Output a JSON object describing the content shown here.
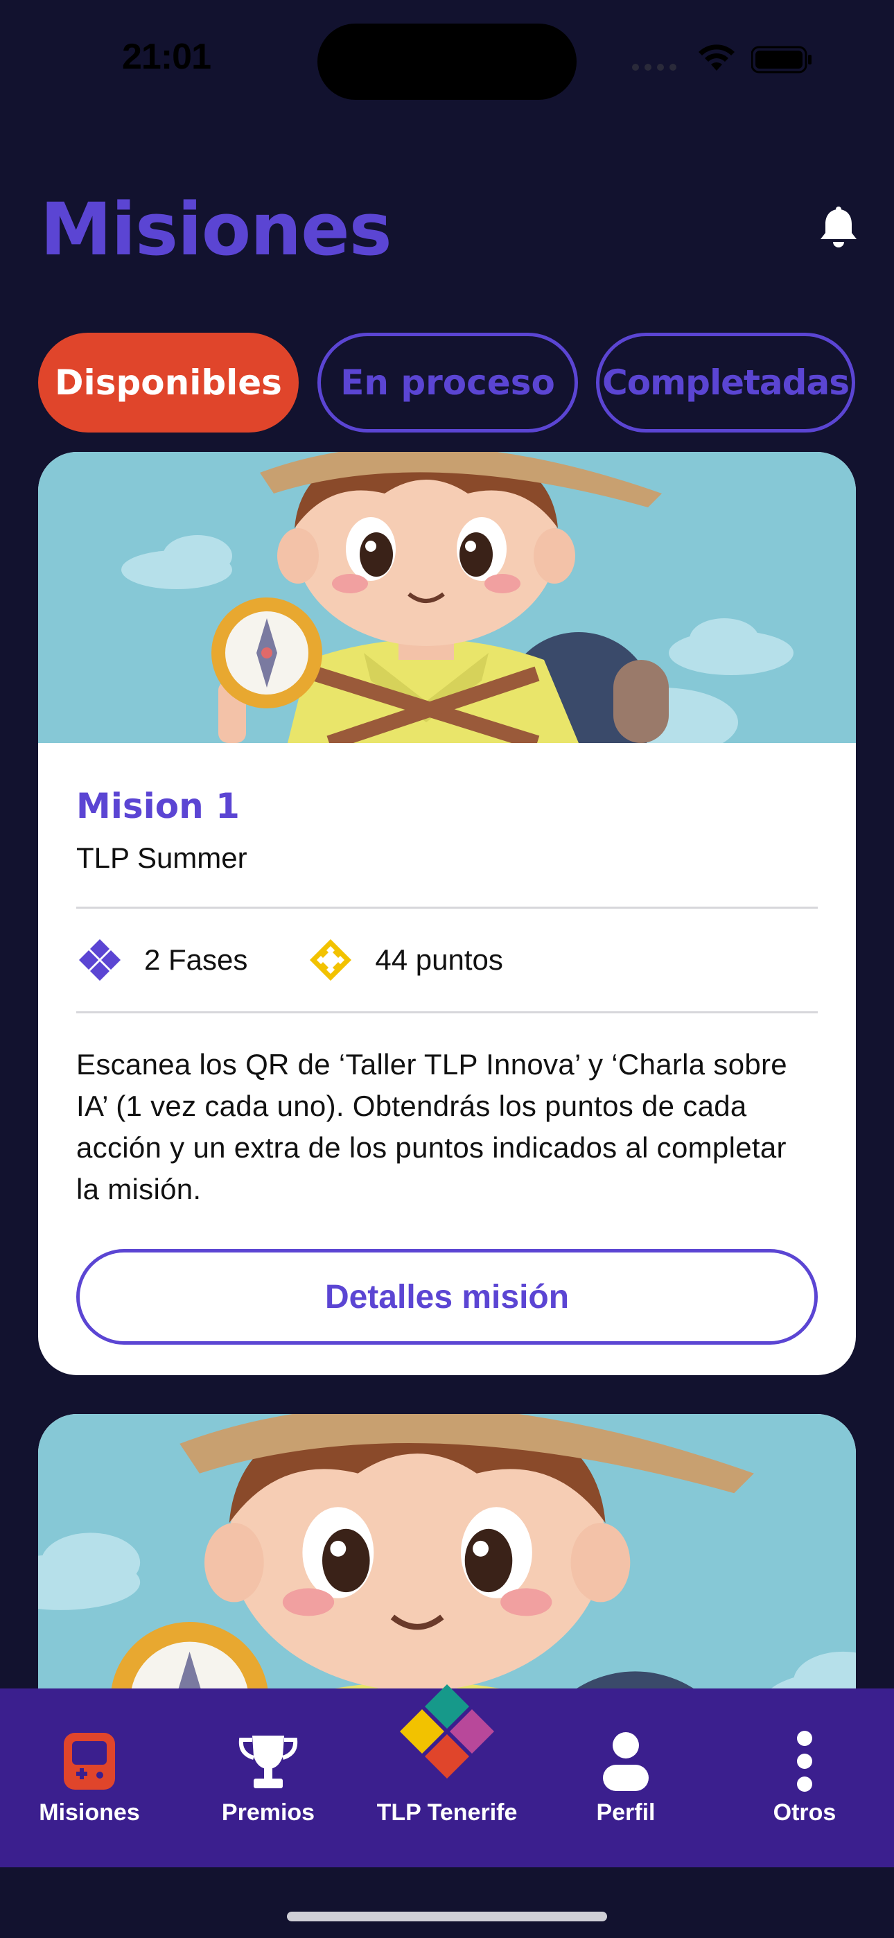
{
  "status_bar": {
    "time": "21:01"
  },
  "header": {
    "title": "Misiones"
  },
  "tabs": [
    {
      "label": "Disponibles",
      "active": true
    },
    {
      "label": "En proceso",
      "active": false
    },
    {
      "label": "Completadas",
      "active": false
    }
  ],
  "missions": [
    {
      "title": "Mision 1",
      "subtitle": "TLP Summer",
      "phases": "2 Fases",
      "points": "44 puntos",
      "description": "Escanea los QR de ‘Taller TLP Innova’ y ‘Charla sobre IA’ (1 vez cada uno). Obtendrás los puntos de cada acción y un extra de los puntos indicados al completar la misión.",
      "button_label": "Detalles misión"
    }
  ],
  "bottom_nav": [
    {
      "label": "Misiones",
      "icon": "gamepad-icon",
      "active": true
    },
    {
      "label": "Premios",
      "icon": "trophy-icon"
    },
    {
      "label": "TLP Tenerife",
      "icon": "tlp-logo-icon"
    },
    {
      "label": "Perfil",
      "icon": "user-icon"
    },
    {
      "label": "Otros",
      "icon": "more-vertical-icon"
    }
  ],
  "colors": {
    "background": "#12122f",
    "accent_purple": "#5b45d3",
    "active_tab": "#e0452b",
    "nav_background": "#3b1f8e"
  }
}
